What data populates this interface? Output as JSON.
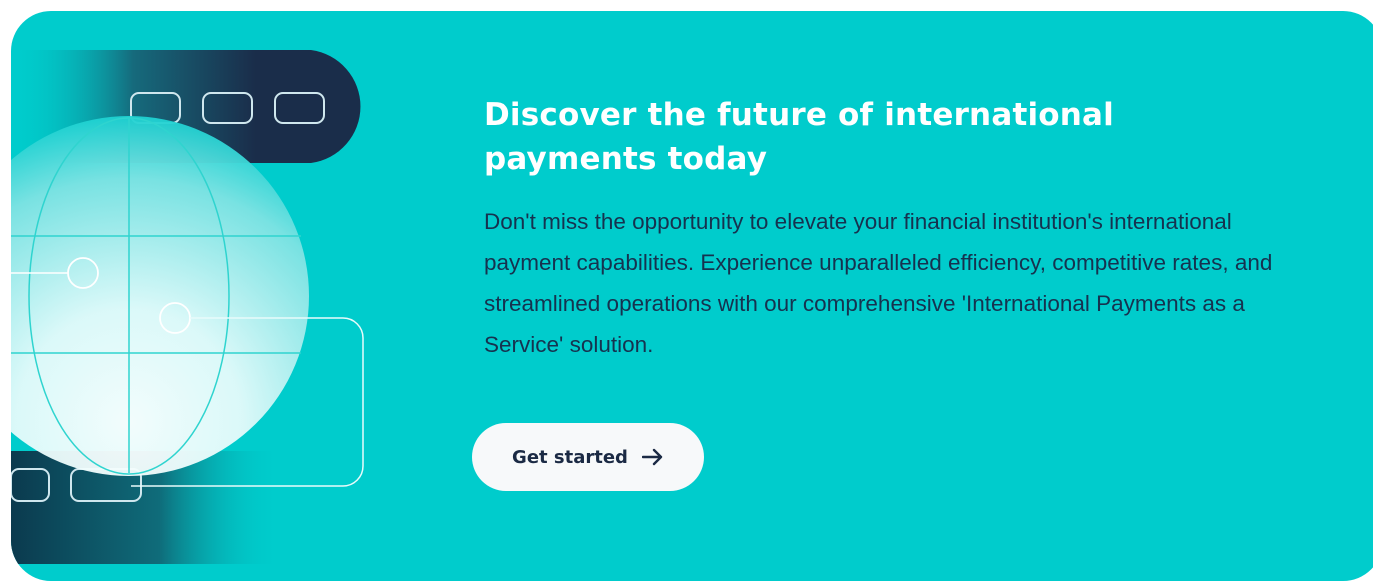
{
  "banner": {
    "headline": "Discover the future of international payments today",
    "body": "Don't miss the opportunity to elevate your financial institution's international payment capabilities. Experience unparalleled efficiency, competitive rates, and streamlined operations with our comprehensive 'International Payments as a Service' solution.",
    "cta_label": "Get started",
    "cta_icon": "arrow-right-icon",
    "illustration_icon": "globe-network-icon"
  },
  "colors": {
    "background": "#00cccc",
    "headline": "#ffffff",
    "body_text": "#16324f",
    "button_bg": "#f7f9fa",
    "button_text": "#1b2a44",
    "dark_pill": "#1a2d4a"
  }
}
